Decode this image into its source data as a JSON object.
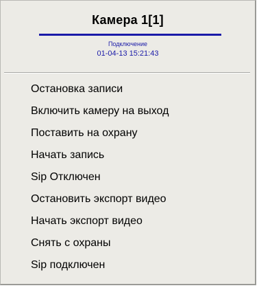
{
  "menu": {
    "title": "Камера 1[1]",
    "status": "Подключение",
    "timestamp": "01-04-13 15:21:43",
    "items": [
      {
        "label": "Остановка записи"
      },
      {
        "label": "Включить камеру на выход"
      },
      {
        "label": "Поставить на охрану"
      },
      {
        "label": "Начать запись"
      },
      {
        "label": "Sip Отключен"
      },
      {
        "label": "Остановить экспорт видео"
      },
      {
        "label": "Начать экспорт видео"
      },
      {
        "label": "Снять с охраны"
      },
      {
        "label": "Sip подключен"
      }
    ]
  }
}
